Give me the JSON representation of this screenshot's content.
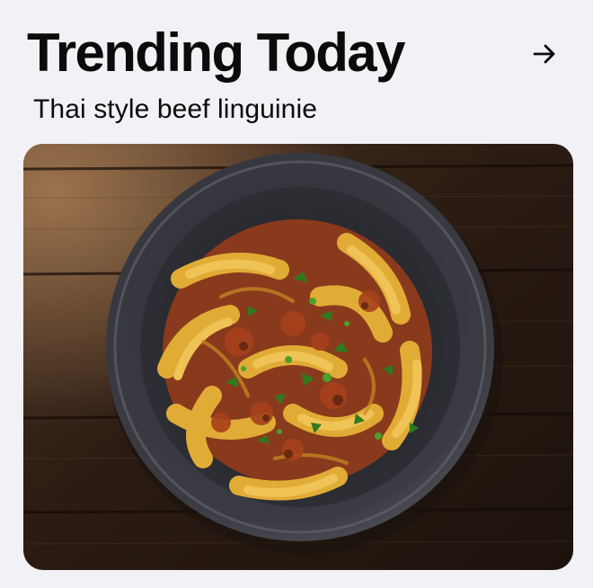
{
  "section": {
    "title": "Trending Today",
    "arrow_icon": "arrow-right-icon"
  },
  "recipe": {
    "name": "Thai style beef linguinie",
    "image_icon": "pasta-bowl-photo"
  },
  "colors": {
    "background": "#f2f1f6",
    "text": "#0b0b0c",
    "table_wood": "#2a1a12",
    "bowl": "#3a3b41",
    "pasta": "#e3b13c",
    "sauce": "#a8431d",
    "herbs": "#2f7a1f"
  }
}
